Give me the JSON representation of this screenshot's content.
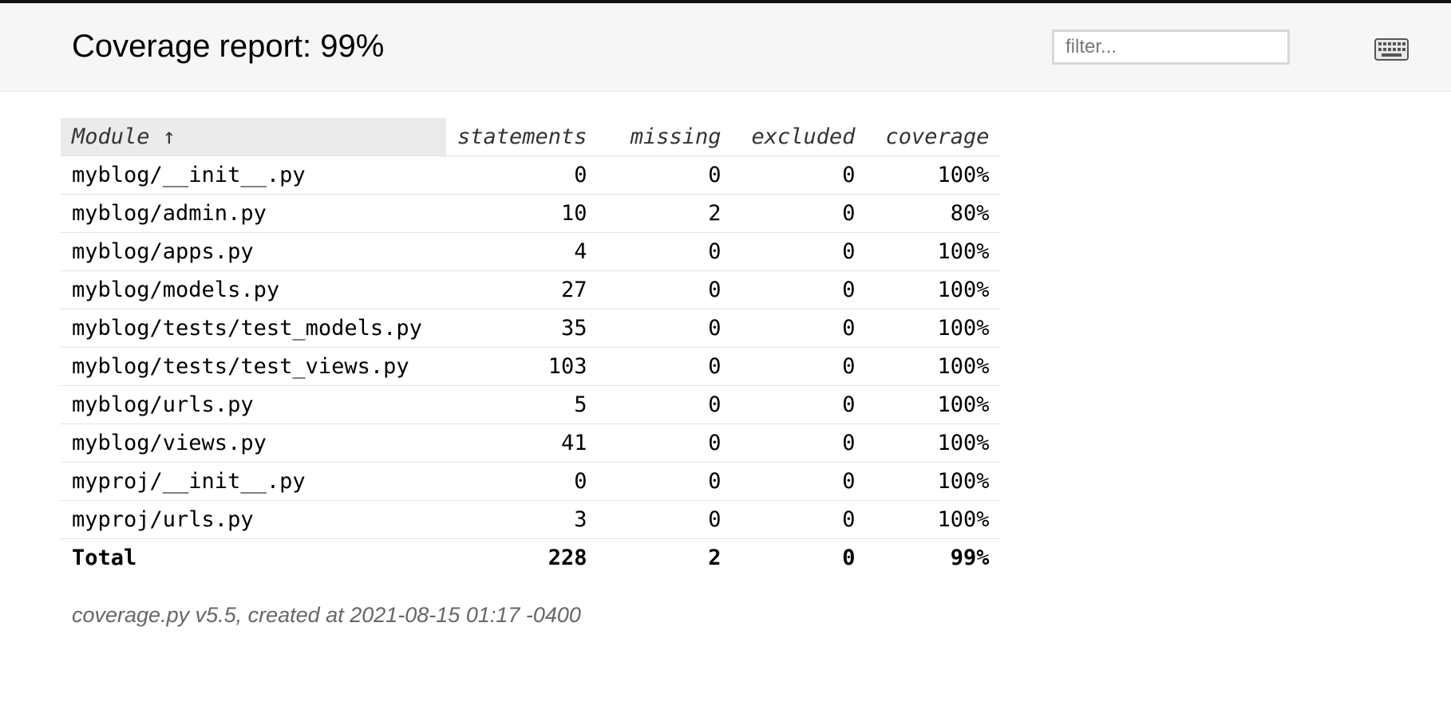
{
  "header": {
    "title": "Coverage report: 99%",
    "filter_placeholder": "filter...",
    "keyboard_icon": "keyboard-icon"
  },
  "table": {
    "columns": [
      "Module ↑",
      "statements",
      "missing",
      "excluded",
      "coverage"
    ],
    "rows": [
      {
        "module": "myblog/__init__.py",
        "statements": "0",
        "missing": "0",
        "excluded": "0",
        "coverage": "100%"
      },
      {
        "module": "myblog/admin.py",
        "statements": "10",
        "missing": "2",
        "excluded": "0",
        "coverage": "80%"
      },
      {
        "module": "myblog/apps.py",
        "statements": "4",
        "missing": "0",
        "excluded": "0",
        "coverage": "100%"
      },
      {
        "module": "myblog/models.py",
        "statements": "27",
        "missing": "0",
        "excluded": "0",
        "coverage": "100%"
      },
      {
        "module": "myblog/tests/test_models.py",
        "statements": "35",
        "missing": "0",
        "excluded": "0",
        "coverage": "100%"
      },
      {
        "module": "myblog/tests/test_views.py",
        "statements": "103",
        "missing": "0",
        "excluded": "0",
        "coverage": "100%"
      },
      {
        "module": "myblog/urls.py",
        "statements": "5",
        "missing": "0",
        "excluded": "0",
        "coverage": "100%"
      },
      {
        "module": "myblog/views.py",
        "statements": "41",
        "missing": "0",
        "excluded": "0",
        "coverage": "100%"
      },
      {
        "module": "myproj/__init__.py",
        "statements": "0",
        "missing": "0",
        "excluded": "0",
        "coverage": "100%"
      },
      {
        "module": "myproj/urls.py",
        "statements": "3",
        "missing": "0",
        "excluded": "0",
        "coverage": "100%"
      }
    ],
    "total": {
      "module": "Total",
      "statements": "228",
      "missing": "2",
      "excluded": "0",
      "coverage": "99%"
    }
  },
  "footer": {
    "text": "coverage.py v5.5, created at 2021-08-15 01:17 -0400"
  },
  "colors": {
    "header_bg": "#f6f6f6",
    "sorted_header_bg": "#ebebeb",
    "footer_text": "#666666"
  }
}
